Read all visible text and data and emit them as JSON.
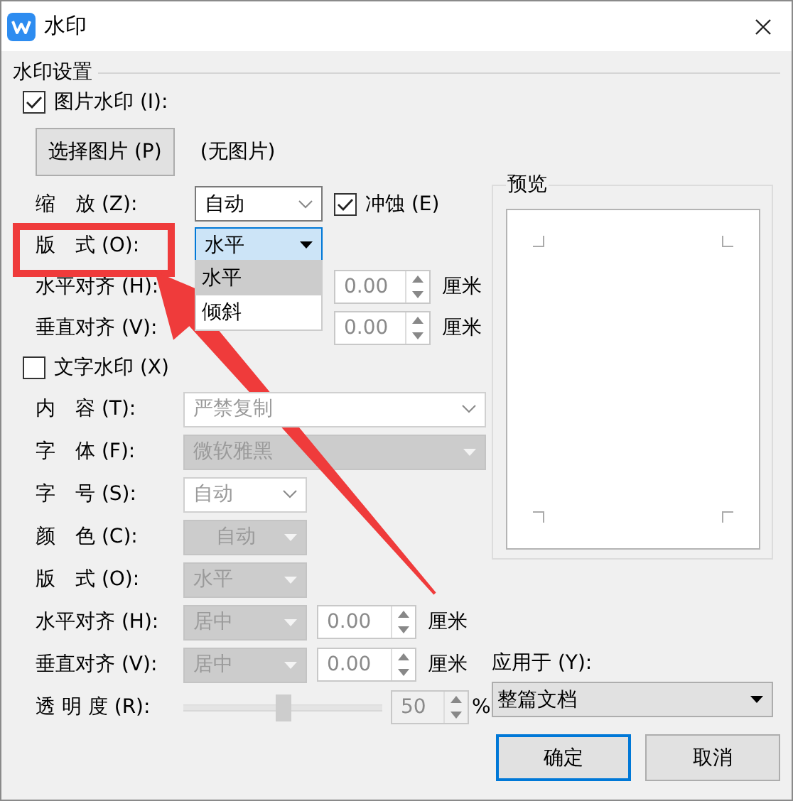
{
  "window": {
    "title": "水印"
  },
  "group_title": "水印设置",
  "picture_watermark": {
    "label": "图片水印 (I):",
    "checked": true,
    "choose_button": "选择图片 (P)",
    "file_status": "(无图片)",
    "scale": {
      "label": "缩　放 (Z):",
      "value": "自动"
    },
    "washout": {
      "label": "冲蚀 (E)",
      "checked": true
    },
    "layout": {
      "label": "版　式 (O):",
      "value": "水平",
      "expanded": true,
      "options": [
        {
          "label": "水平",
          "selected": true
        },
        {
          "label": "倾斜",
          "selected": false
        }
      ]
    },
    "h_align": {
      "label": "水平对齐 (H):",
      "value": "0.00",
      "unit": "厘米",
      "disabled": true
    },
    "v_align": {
      "label": "垂直对齐 (V):",
      "value": "0.00",
      "unit": "厘米",
      "disabled": true
    }
  },
  "text_watermark": {
    "label": "文字水印 (X)",
    "checked": false,
    "rows": [
      {
        "kind": "combo",
        "label": "内　容 (T):",
        "value": "严禁复制",
        "wide": true
      },
      {
        "kind": "select",
        "label": "字　体 (F):",
        "value": "微软雅黑",
        "wide": true
      },
      {
        "kind": "combo",
        "label": "字　号 (S):",
        "value": "自动",
        "wide": false
      },
      {
        "kind": "select",
        "label": "颜　色 (C):",
        "value": "自动",
        "wide": false,
        "centered": true
      },
      {
        "kind": "select",
        "label": "版　式 (O):",
        "value": "水平",
        "wide": false
      },
      {
        "kind": "align",
        "label": "水平对齐 (H):",
        "value": "居中",
        "number": "0.00",
        "unit": "厘米"
      },
      {
        "kind": "align",
        "label": "垂直对齐 (V):",
        "value": "居中",
        "number": "0.00",
        "unit": "厘米"
      },
      {
        "kind": "slider",
        "label": "透 明 度 (R):",
        "level": 0.5,
        "number": "50",
        "unit": "%"
      }
    ]
  },
  "preview": {
    "title": "预览"
  },
  "apply_to": {
    "label": "应用于 (Y):",
    "value": "整篇文档"
  },
  "buttons": [
    {
      "label": "确定",
      "default": true
    },
    {
      "label": "取消",
      "default": false
    }
  ]
}
